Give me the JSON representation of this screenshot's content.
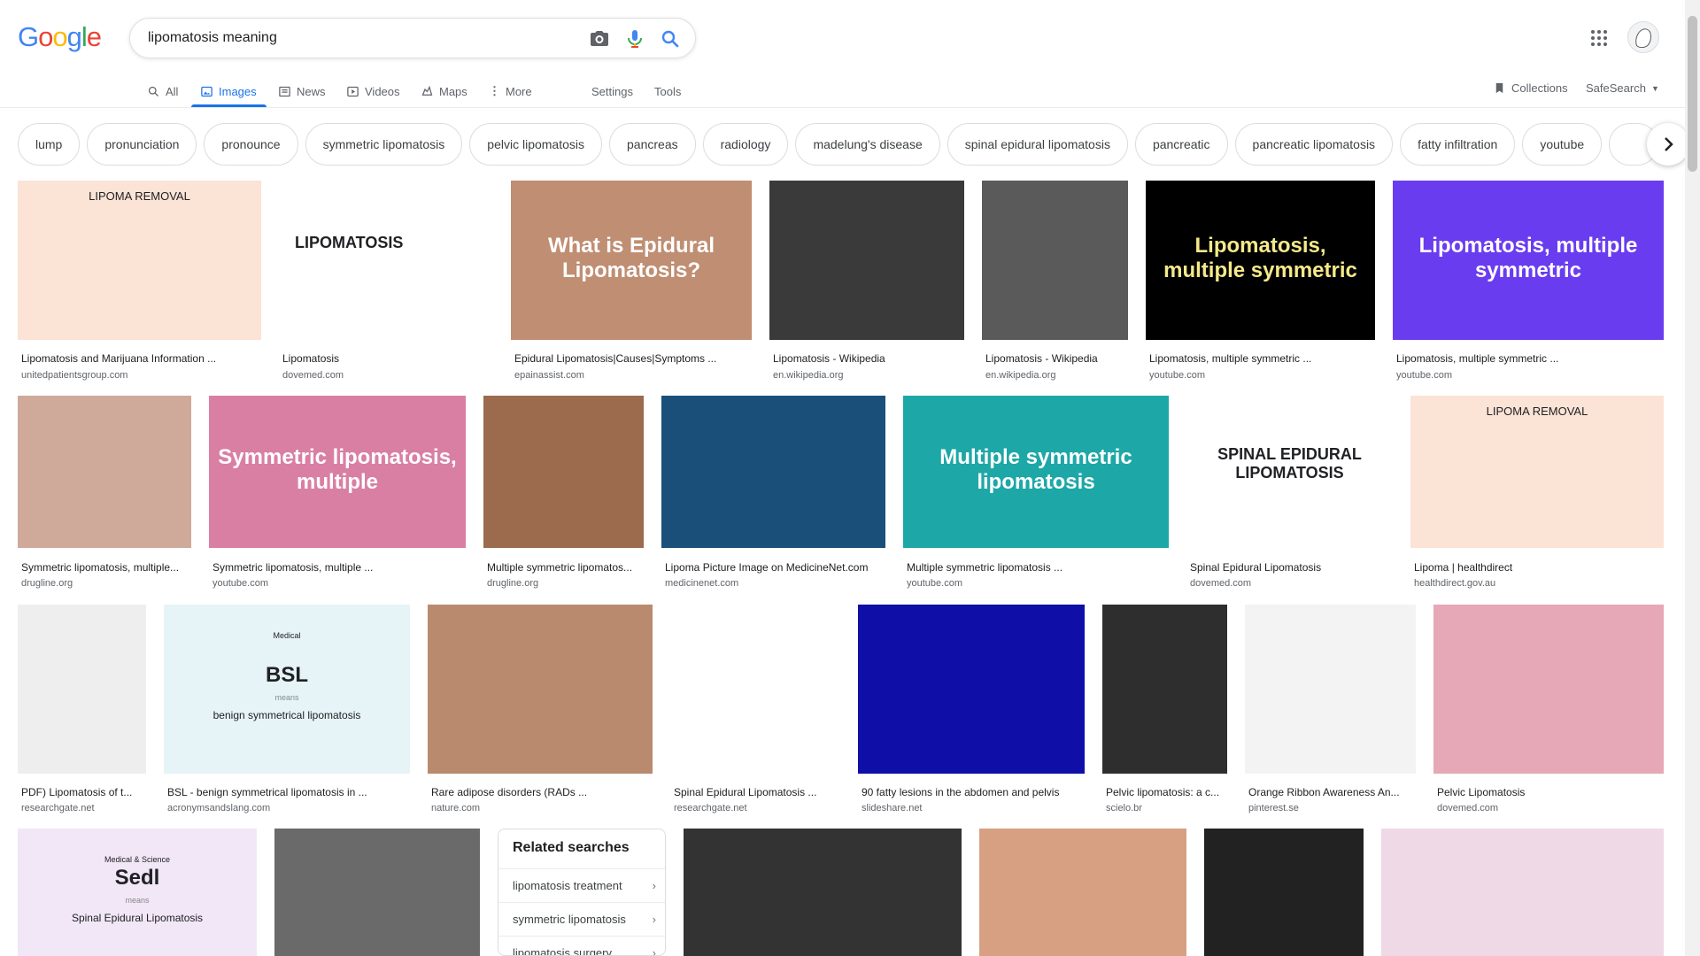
{
  "search": {
    "query": "lipomatosis meaning"
  },
  "logo": [
    "G",
    "o",
    "o",
    "g",
    "l",
    "e"
  ],
  "tabs": [
    {
      "label": "All"
    },
    {
      "label": "Images"
    },
    {
      "label": "News"
    },
    {
      "label": "Videos"
    },
    {
      "label": "Maps"
    },
    {
      "label": "More"
    }
  ],
  "tools": {
    "settings": "Settings",
    "tools": "Tools",
    "collections": "Collections",
    "safesearch": "SafeSearch"
  },
  "chips": [
    "lump",
    "pronunciation",
    "pronounce",
    "symmetric lipomatosis",
    "pelvic lipomatosis",
    "pancreas",
    "radiology",
    "madelung's disease",
    "spinal epidural lipomatosis",
    "pancreatic",
    "pancreatic lipomatosis",
    "fatty infiltration",
    "youtube"
  ],
  "results": [
    {
      "caption": "Lipomatosis and Marijuana Information ...",
      "source": "unitedpatientsgroup.com",
      "overlay": "LIPOMA REMOVAL",
      "color": "#fbe3d6"
    },
    {
      "caption": "Lipomatosis",
      "source": "dovemed.com",
      "overlay": "LIPOMATOSIS",
      "color": "#ffffff"
    },
    {
      "caption": "Epidural Lipomatosis|Causes|Symptoms ...",
      "source": "epainassist.com",
      "overlay": "What is Epidural Lipomatosis?",
      "color": "#c08e72"
    },
    {
      "caption": "Lipomatosis - Wikipedia",
      "source": "en.wikipedia.org",
      "overlay": "",
      "color": "#3a3a3a"
    },
    {
      "caption": "Lipomatosis - Wikipedia",
      "source": "en.wikipedia.org",
      "overlay": "",
      "color": "#5a5a5a"
    },
    {
      "caption": "Lipomatosis, multiple symmetric ...",
      "source": "youtube.com",
      "overlay": "Lipomatosis, multiple symmetric",
      "color": "#000000"
    },
    {
      "caption": "Lipomatosis, multiple symmetric ...",
      "source": "youtube.com",
      "overlay": "Lipomatosis, multiple symmetric",
      "color": "#6a3cf0"
    },
    {
      "caption": "Symmetric lipomatosis, multiple...",
      "source": "drugline.org",
      "overlay": "",
      "color": "#cfa99a"
    },
    {
      "caption": "Symmetric lipomatosis, multiple ...",
      "source": "youtube.com",
      "overlay": "Symmetric lipomatosis, multiple",
      "color": "#d97fa4"
    },
    {
      "caption": "Multiple symmetric lipomatos...",
      "source": "drugline.org",
      "overlay": "",
      "color": "#9c6a4d"
    },
    {
      "caption": "Lipoma Picture Image on MedicineNet.com",
      "source": "medicinenet.com",
      "overlay": "",
      "color": "#1a4f7a"
    },
    {
      "caption": "Multiple symmetric lipomatosis ...",
      "source": "youtube.com",
      "overlay": "Multiple symmetric lipomatosis",
      "color": "#1ea7a7"
    },
    {
      "caption": "Spinal Epidural Lipomatosis",
      "source": "dovemed.com",
      "overlay": "SPINAL EPIDURAL LIPOMATOSIS",
      "color": "#ffffff"
    },
    {
      "caption": "Lipoma | healthdirect",
      "source": "healthdirect.gov.au",
      "overlay": "LIPOMA REMOVAL",
      "color": "#fbe3d6"
    },
    {
      "caption": "PDF) Lipomatosis of t...",
      "source": "researchgate.net",
      "overlay": "",
      "color": "#eeeeee"
    },
    {
      "caption": "BSL - benign symmetrical lipomatosis in ...",
      "source": "acronymsandslang.com",
      "overlay": "BSL",
      "sub1": "Medical",
      "sub2": "means",
      "sub3": "benign symmetrical lipomatosis",
      "color": "#e6f4f8"
    },
    {
      "caption": "Rare adipose disorders (RADs ...",
      "source": "nature.com",
      "overlay": "",
      "color": "#b98a6e"
    },
    {
      "caption": "Spinal Epidural Lipomatosis ...",
      "source": "researchgate.net",
      "overlay": "",
      "color": "#ffffff"
    },
    {
      "caption": "90 fatty lesions in the abdomen and pelvis",
      "source": "slideshare.net",
      "overlay": "",
      "color": "#0f0fa8"
    },
    {
      "caption": "Pelvic lipomatosis: a c...",
      "source": "scielo.br",
      "overlay": "",
      "color": "#2e2e2e"
    },
    {
      "caption": "Orange Ribbon Awareness An...",
      "source": "pinterest.se",
      "overlay": "",
      "color": "#f3f3f3"
    },
    {
      "caption": "Pelvic Lipomatosis",
      "source": "dovemed.com",
      "overlay": "",
      "color": "#e6a8b6"
    },
    {
      "caption": "",
      "source": "",
      "overlay": "Sedl",
      "sub1": "Medical & Science",
      "sub2": "means",
      "sub3": "Spinal Epidural Lipomatosis",
      "color": "#f1e7f7"
    },
    {
      "caption": "",
      "source": "",
      "overlay": "",
      "color": "#6a6a6a"
    },
    {
      "caption": "",
      "source": "",
      "overlay": "",
      "color": "#333333"
    },
    {
      "caption": "",
      "source": "",
      "overlay": "",
      "color": "#d7a083"
    },
    {
      "caption": "",
      "source": "",
      "overlay": "",
      "color": "#222222"
    },
    {
      "caption": "",
      "source": "",
      "overlay": "",
      "color": "#f0d9e6"
    }
  ],
  "related": {
    "title": "Related searches",
    "items": [
      "lipomatosis treatment",
      "symmetric lipomatosis",
      "lipomatosis surgery"
    ]
  }
}
